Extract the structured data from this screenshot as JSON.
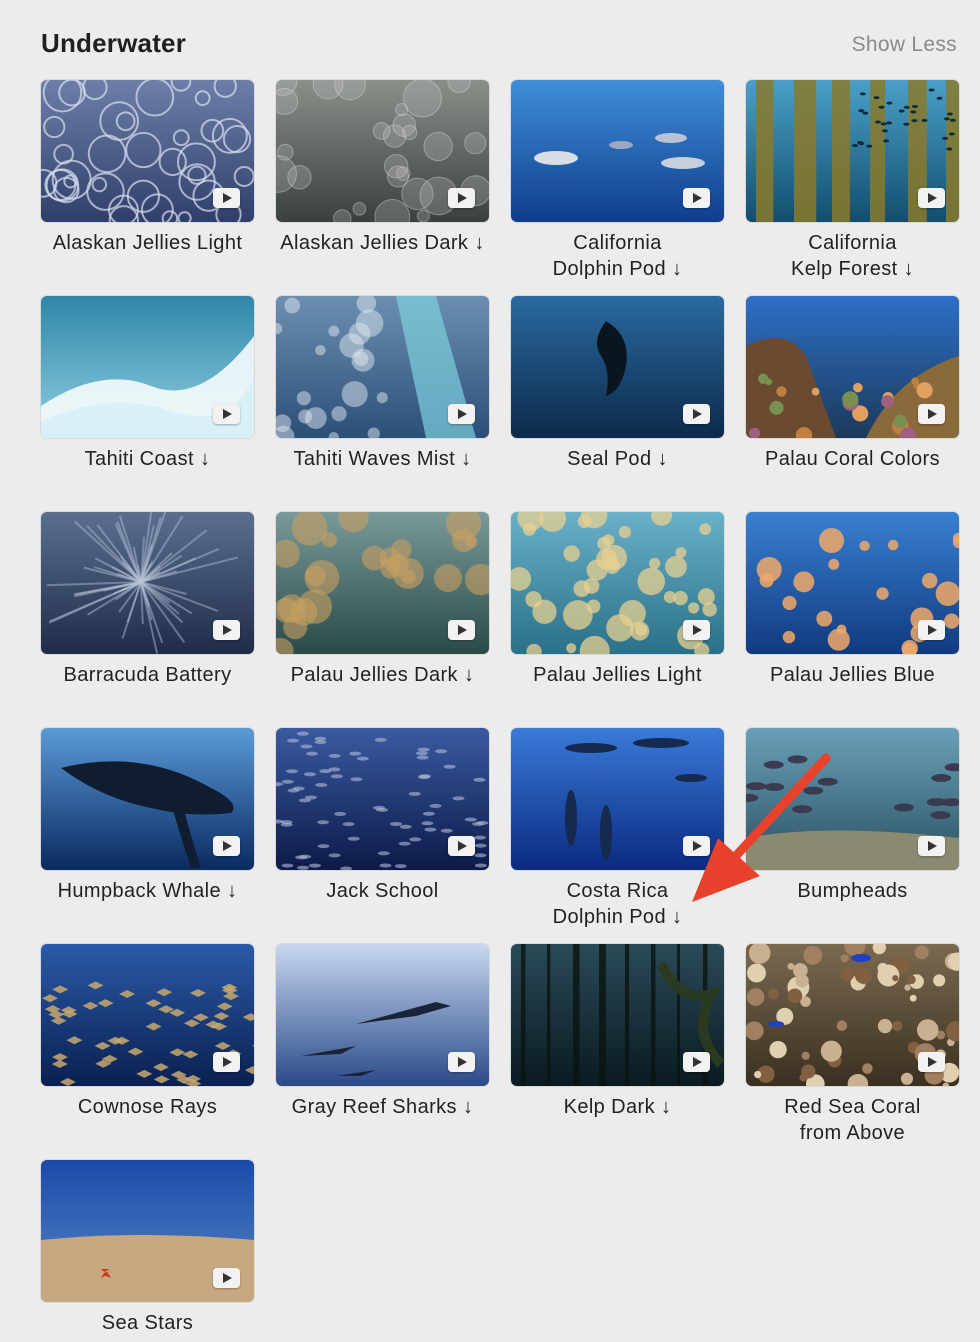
{
  "section": {
    "title": "Underwater",
    "toggle_label": "Show Less"
  },
  "tiles": [
    {
      "label": "Alaskan Jellies Light",
      "line2": "",
      "download": false,
      "scene": "jellies-light"
    },
    {
      "label": "Alaskan Jellies Dark",
      "line2": "",
      "download": true,
      "scene": "jellies-dark"
    },
    {
      "label": "California",
      "line2": "Dolphin Pod",
      "download": true,
      "scene": "dolphins"
    },
    {
      "label": "California",
      "line2": "Kelp Forest",
      "download": true,
      "scene": "kelp-forest"
    },
    {
      "label": "Tahiti Coast",
      "line2": "",
      "download": true,
      "scene": "coast"
    },
    {
      "label": "Tahiti Waves Mist",
      "line2": "",
      "download": true,
      "scene": "waves"
    },
    {
      "label": "Seal Pod",
      "line2": "",
      "download": true,
      "scene": "seal"
    },
    {
      "label": "Palau Coral Colors",
      "line2": "",
      "download": false,
      "scene": "coral"
    },
    {
      "label": "Barracuda Battery",
      "line2": "",
      "download": false,
      "scene": "barracuda"
    },
    {
      "label": "Palau Jellies Dark",
      "line2": "",
      "download": true,
      "scene": "palau-dark"
    },
    {
      "label": "Palau Jellies Light",
      "line2": "",
      "download": false,
      "scene": "palau-light"
    },
    {
      "label": "Palau Jellies Blue",
      "line2": "",
      "download": false,
      "scene": "palau-blue"
    },
    {
      "label": "Humpback Whale",
      "line2": "",
      "download": true,
      "scene": "whale"
    },
    {
      "label": "Jack School",
      "line2": "",
      "download": false,
      "scene": "jack"
    },
    {
      "label": "Costa Rica",
      "line2": "Dolphin Pod",
      "download": true,
      "scene": "costa-dolphins"
    },
    {
      "label": "Bumpheads",
      "line2": "",
      "download": false,
      "scene": "bumpheads"
    },
    {
      "label": "Cownose Rays",
      "line2": "",
      "download": false,
      "scene": "rays"
    },
    {
      "label": "Gray Reef Sharks",
      "line2": "",
      "download": true,
      "scene": "sharks"
    },
    {
      "label": "Kelp Dark",
      "line2": "",
      "download": true,
      "scene": "kelp-dark"
    },
    {
      "label": "Red Sea Coral",
      "line2": "from Above",
      "download": false,
      "scene": "red-coral"
    },
    {
      "label": "Sea Stars",
      "line2": "",
      "download": false,
      "scene": "sea-stars"
    }
  ],
  "icons": {
    "play": "play-icon",
    "download": "download-arrow-icon"
  },
  "download_glyph": "↓",
  "annotation": {
    "arrow_color": "#e8412c"
  }
}
